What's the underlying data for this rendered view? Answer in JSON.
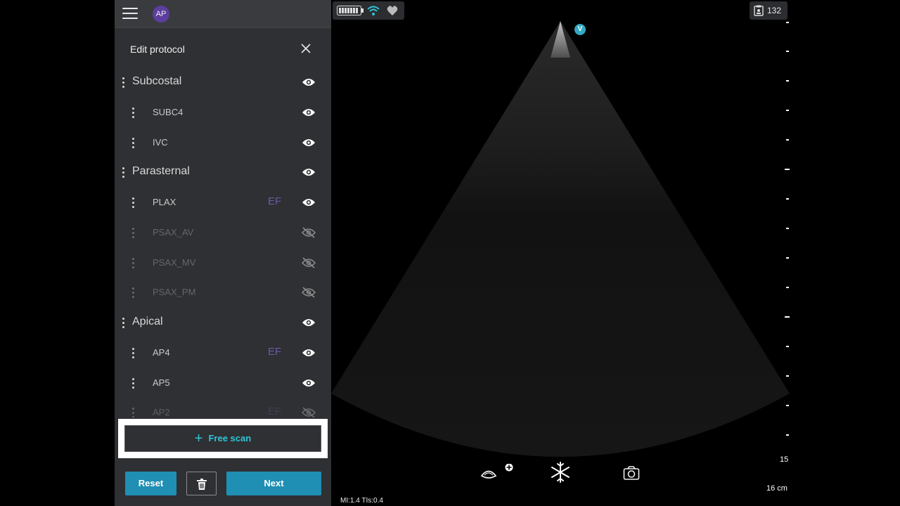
{
  "header": {
    "avatar_initials": "AP",
    "status_count": "132",
    "probe_marker": "V"
  },
  "panel": {
    "title": "Edit protocol",
    "rows": [
      {
        "label": "Subcostal",
        "kind": "group",
        "visible": true,
        "tag": ""
      },
      {
        "label": "SUBC4",
        "kind": "item",
        "visible": true,
        "tag": ""
      },
      {
        "label": "IVC",
        "kind": "item",
        "visible": true,
        "tag": ""
      },
      {
        "label": "Parasternal",
        "kind": "group",
        "visible": true,
        "tag": ""
      },
      {
        "label": "PLAX",
        "kind": "item",
        "visible": true,
        "tag": "EF"
      },
      {
        "label": "PSAX_AV",
        "kind": "item",
        "visible": false,
        "tag": ""
      },
      {
        "label": "PSAX_MV",
        "kind": "item",
        "visible": false,
        "tag": ""
      },
      {
        "label": "PSAX_PM",
        "kind": "item",
        "visible": false,
        "tag": ""
      },
      {
        "label": "Apical",
        "kind": "group",
        "visible": true,
        "tag": ""
      },
      {
        "label": "AP4",
        "kind": "item",
        "visible": true,
        "tag": "EF"
      },
      {
        "label": "AP5",
        "kind": "item",
        "visible": true,
        "tag": ""
      },
      {
        "label": "AP2",
        "kind": "item",
        "visible": false,
        "tag": "EF"
      }
    ],
    "free_scan_label": "Free scan",
    "reset_label": "Reset",
    "next_label": "Next"
  },
  "image": {
    "depth_label": "16 cm",
    "scale_mark": "15",
    "mi_readout": "MI:1.4  TIs:0.4"
  },
  "colors": {
    "accent": "#1f8fb3",
    "free_scan_text": "#2fc4d9",
    "ef_tag": "#6e5aa7",
    "avatar": "#5b3e9e",
    "panel_bg": "#2f3033"
  }
}
